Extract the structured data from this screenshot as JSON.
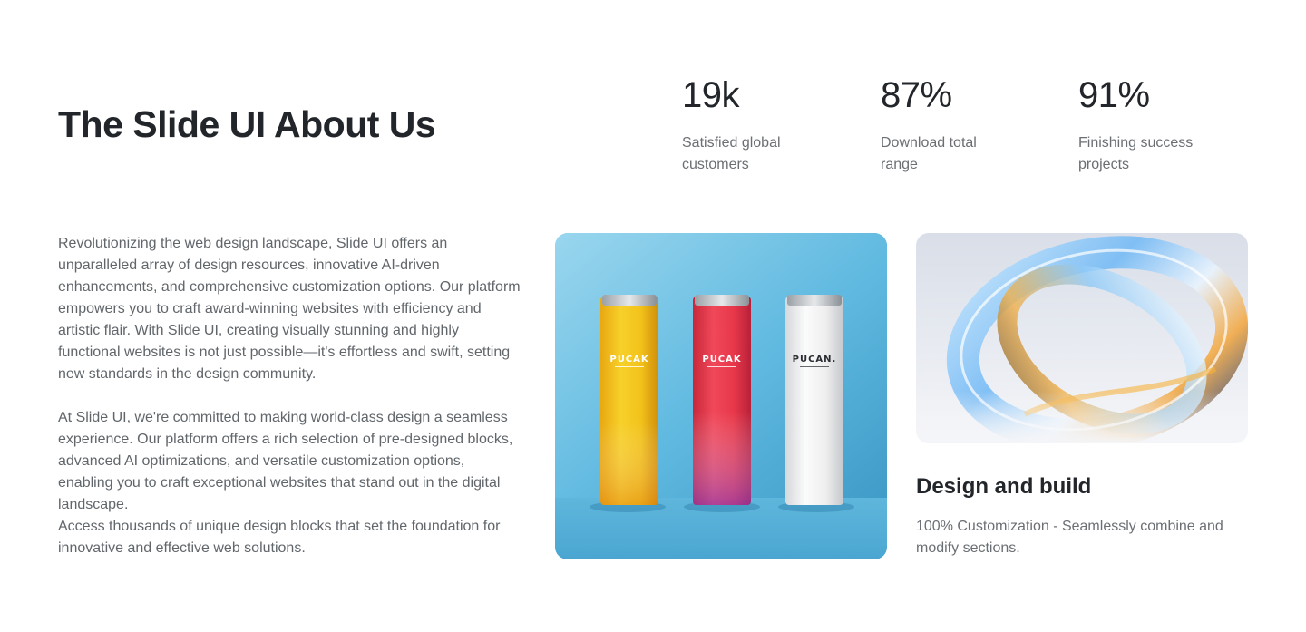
{
  "section": {
    "title": "The Slide UI About Us"
  },
  "stats": [
    {
      "value": "19k",
      "label": "Satisfied global customers"
    },
    {
      "value": "87%",
      "label": "Download total range"
    },
    {
      "value": "91%",
      "label": "Finishing success projects"
    }
  ],
  "body": {
    "paragraph_1": "Revolutionizing the web design landscape, Slide UI offers an unparalleled array of design resources, innovative AI-driven enhancements, and comprehensive customization options. Our platform empowers you to craft award-winning websites with efficiency and artistic flair. With Slide UI, creating visually stunning and highly functional websites is not just possible—it's effortless and swift, setting new standards in the design community.",
    "paragraph_2": "At Slide UI, we're committed to making world-class design a seamless experience. Our platform offers a rich selection of pre-designed blocks, advanced AI optimizations, and versatile customization options, enabling you to craft exceptional websites that stand out in the digital landscape.",
    "paragraph_3": "Access thousands of unique design blocks that set the foundation for innovative and effective web solutions."
  },
  "product_image": {
    "cans": [
      {
        "brand": "PUCAK",
        "color": "#f2c21a"
      },
      {
        "brand": "PUCAK",
        "color": "#e8384a"
      },
      {
        "brand": "PUCAN.",
        "color": "#eeeeee"
      }
    ]
  },
  "feature": {
    "title": "Design and build",
    "description": "100% Customization - Seamlessly combine and modify sections."
  },
  "colors": {
    "heading": "#22262a",
    "body_text": "#61666b",
    "muted_text": "#6b6f74",
    "image_background": "#5bb6dd"
  }
}
